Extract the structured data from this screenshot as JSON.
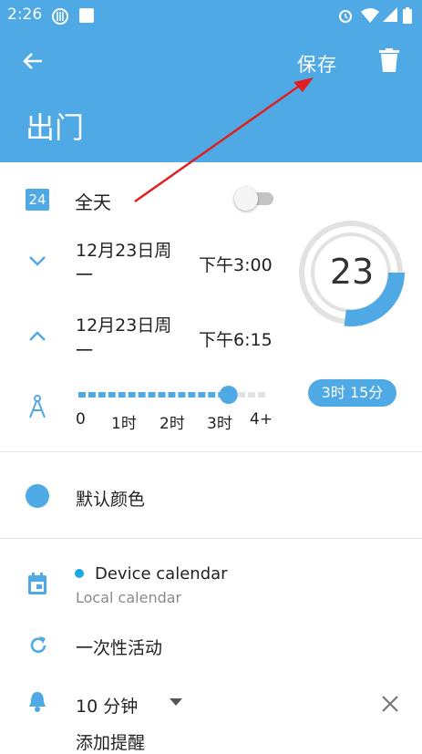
{
  "status_bar": {
    "time": "2:26"
  },
  "toolbar": {
    "save_label": "保存"
  },
  "event": {
    "title": "出门"
  },
  "all_day": {
    "badge_day": "24",
    "label": "全天",
    "enabled": false
  },
  "start": {
    "date": "12月23日周",
    "date_line2": "一",
    "time": "下午3:00"
  },
  "end": {
    "date": "12月23日周",
    "date_line2": "一",
    "time": "下午6:15"
  },
  "day_ring": {
    "day": "23",
    "fill_fraction": 0.27
  },
  "duration": {
    "badge": "3时 15分",
    "ticks": [
      "0",
      "1时",
      "2时",
      "3时",
      "4+"
    ],
    "value_hours": 3.25
  },
  "color": {
    "label": "默认颜色",
    "hex": "#4fa9e4"
  },
  "calendar": {
    "name": "Device calendar",
    "account": "Local calendar",
    "dot_color": "#1ea7e6"
  },
  "repeat": {
    "label": "一次性活动"
  },
  "reminder": {
    "value": "10 分钟",
    "add_label": "添加提醒"
  }
}
